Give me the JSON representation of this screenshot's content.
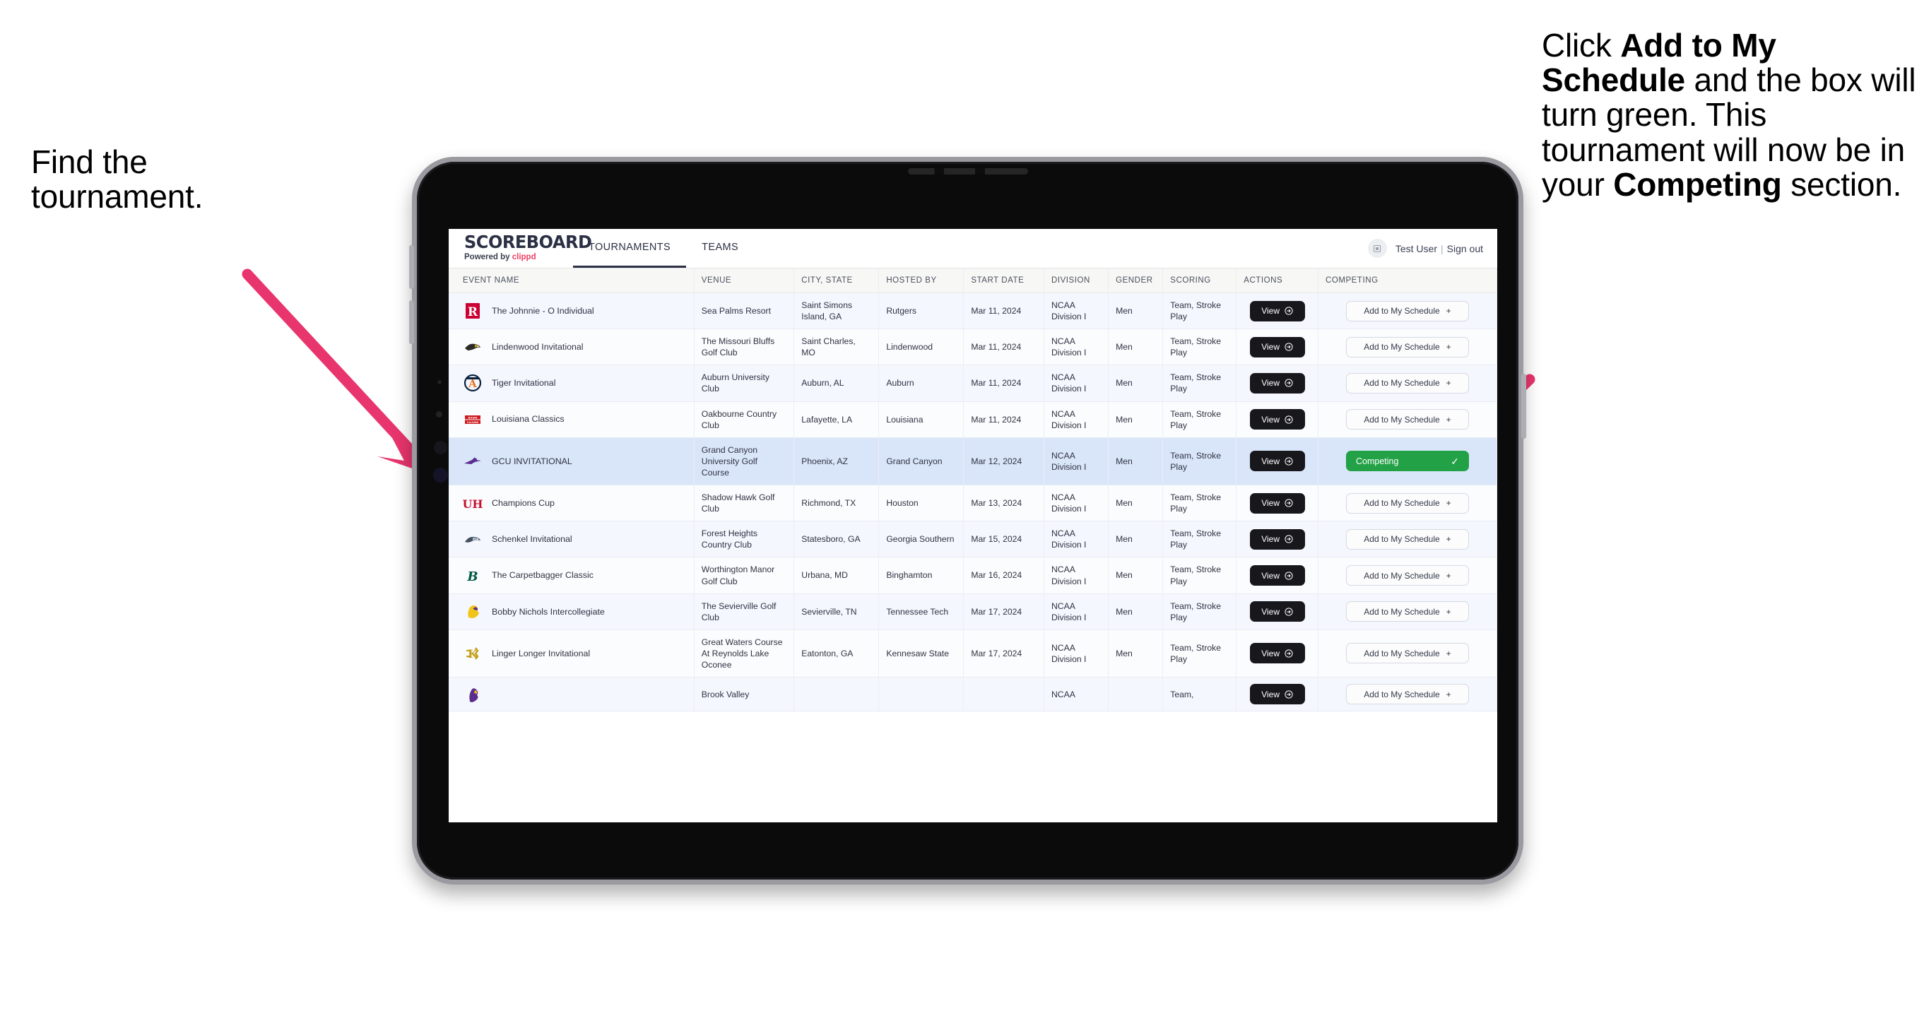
{
  "annotations": {
    "left": {
      "line1": "Find the",
      "line2": "tournament."
    },
    "right": {
      "seg1": "Click ",
      "bold1": "Add to My Schedule",
      "seg2": " and the box will turn green. This tournament will now be in your ",
      "bold2": "Competing",
      "seg3": " section."
    },
    "arrow_color": "#e8356d"
  },
  "app": {
    "brand": {
      "title": "SCOREBOARD",
      "powered_prefix": "Powered by ",
      "powered_name": "clippd"
    },
    "nav": [
      {
        "label": "TOURNAMENTS",
        "active": true
      },
      {
        "label": "TEAMS",
        "active": false
      }
    ],
    "account": {
      "avatar_icon": "user-avatar-icon",
      "user_name": "Test User",
      "separator": "|",
      "sign_out": "Sign out"
    },
    "table": {
      "columns": [
        "EVENT NAME",
        "VENUE",
        "CITY, STATE",
        "HOSTED BY",
        "START DATE",
        "DIVISION",
        "GENDER",
        "SCORING",
        "ACTIONS",
        "COMPETING"
      ],
      "view_label": "View",
      "add_label": "Add to My Schedule",
      "add_plus": "+",
      "competing_label": "Competing",
      "competing_check": "✓",
      "rows": [
        {
          "logo": "rutgers-logo",
          "event": "The Johnnie - O Individual",
          "venue": "Sea Palms Resort",
          "city": "Saint Simons Island, GA",
          "hosted_by": "Rutgers",
          "start_date": "Mar 11, 2024",
          "division": "NCAA Division I",
          "gender": "Men",
          "scoring": "Team, Stroke Play",
          "competing": false
        },
        {
          "logo": "lindenwood-logo",
          "event": "Lindenwood Invitational",
          "venue": "The Missouri Bluffs Golf Club",
          "city": "Saint Charles, MO",
          "hosted_by": "Lindenwood",
          "start_date": "Mar 11, 2024",
          "division": "NCAA Division I",
          "gender": "Men",
          "scoring": "Team, Stroke Play",
          "competing": false
        },
        {
          "logo": "auburn-logo",
          "event": "Tiger Invitational",
          "venue": "Auburn University Club",
          "city": "Auburn, AL",
          "hosted_by": "Auburn",
          "start_date": "Mar 11, 2024",
          "division": "NCAA Division I",
          "gender": "Men",
          "scoring": "Team, Stroke Play",
          "competing": false
        },
        {
          "logo": "louisiana-logo",
          "event": "Louisiana Classics",
          "venue": "Oakbourne Country Club",
          "city": "Lafayette, LA",
          "hosted_by": "Louisiana",
          "start_date": "Mar 11, 2024",
          "division": "NCAA Division I",
          "gender": "Men",
          "scoring": "Team, Stroke Play",
          "competing": false
        },
        {
          "logo": "gcu-logo",
          "event": "GCU INVITATIONAL",
          "venue": "Grand Canyon University Golf Course",
          "city": "Phoenix, AZ",
          "hosted_by": "Grand Canyon",
          "start_date": "Mar 12, 2024",
          "division": "NCAA Division I",
          "gender": "Men",
          "scoring": "Team, Stroke Play",
          "competing": true
        },
        {
          "logo": "houston-logo",
          "event": "Champions Cup",
          "venue": "Shadow Hawk Golf Club",
          "city": "Richmond, TX",
          "hosted_by": "Houston",
          "start_date": "Mar 13, 2024",
          "division": "NCAA Division I",
          "gender": "Men",
          "scoring": "Team, Stroke Play",
          "competing": false
        },
        {
          "logo": "georgia-southern-logo",
          "event": "Schenkel Invitational",
          "venue": "Forest Heights Country Club",
          "city": "Statesboro, GA",
          "hosted_by": "Georgia Southern",
          "start_date": "Mar 15, 2024",
          "division": "NCAA Division I",
          "gender": "Men",
          "scoring": "Team, Stroke Play",
          "competing": false
        },
        {
          "logo": "binghamton-logo",
          "event": "The Carpetbagger Classic",
          "venue": "Worthington Manor Golf Club",
          "city": "Urbana, MD",
          "hosted_by": "Binghamton",
          "start_date": "Mar 16, 2024",
          "division": "NCAA Division I",
          "gender": "Men",
          "scoring": "Team, Stroke Play",
          "competing": false
        },
        {
          "logo": "tennessee-tech-logo",
          "event": "Bobby Nichols Intercollegiate",
          "venue": "The Sevierville Golf Club",
          "city": "Sevierville, TN",
          "hosted_by": "Tennessee Tech",
          "start_date": "Mar 17, 2024",
          "division": "NCAA Division I",
          "gender": "Men",
          "scoring": "Team, Stroke Play",
          "competing": false
        },
        {
          "logo": "kennesaw-state-logo",
          "event": "Linger Longer Invitational",
          "venue": "Great Waters Course At Reynolds Lake Oconee",
          "city": "Eatonton, GA",
          "hosted_by": "Kennesaw State",
          "start_date": "Mar 17, 2024",
          "division": "NCAA Division I",
          "gender": "Men",
          "scoring": "Team, Stroke Play",
          "competing": false
        },
        {
          "logo": "ecu-logo",
          "event": "",
          "venue": "Brook Valley",
          "city": "",
          "hosted_by": "",
          "start_date": "",
          "division": "NCAA",
          "gender": "",
          "scoring": "Team,",
          "competing": false
        }
      ]
    }
  }
}
